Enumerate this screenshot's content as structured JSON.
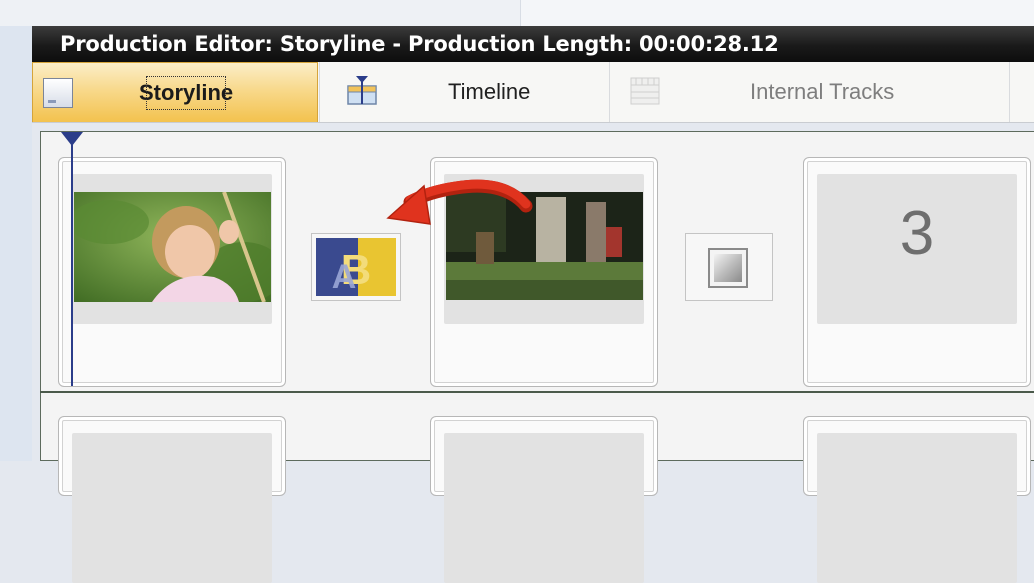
{
  "window": {
    "title": "Production Editor: Storyline - Production Length: 00:00:28.12"
  },
  "tabs": [
    {
      "label": "Storyline",
      "icon": "storyline-icon",
      "active": true
    },
    {
      "label": "Timeline",
      "icon": "timeline-icon",
      "active": false
    },
    {
      "label": "Internal Tracks",
      "icon": "internal-tracks-icon",
      "active": false
    }
  ],
  "storyline": {
    "slots": [
      {
        "content": "video-clip",
        "description": "girl on swing"
      },
      {
        "content": "video-clip",
        "description": "outdoor scene"
      },
      {
        "content": "empty",
        "number": "3"
      }
    ],
    "transitions": [
      {
        "type": "wipe-transition",
        "active": true
      },
      {
        "type": "empty-transition",
        "active": false
      }
    ]
  },
  "colors": {
    "active_tab": "#f3c24e",
    "title_bar": "#1a1a1a",
    "playhead": "#2b3d8a",
    "annotation_arrow": "#e0331e"
  }
}
